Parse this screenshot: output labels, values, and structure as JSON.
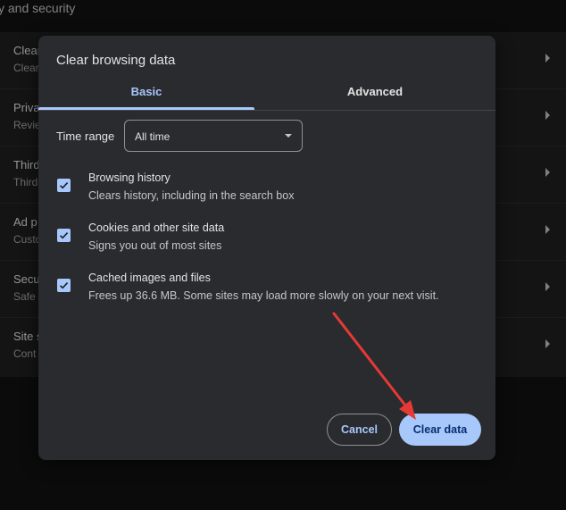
{
  "background": {
    "section_title": "y and security",
    "rows": [
      {
        "title": "Clear",
        "sub": "Clear"
      },
      {
        "title": "Priva",
        "sub": "Revie"
      },
      {
        "title": "Third",
        "sub": "Third"
      },
      {
        "title": "Ad p",
        "sub": "Custo"
      },
      {
        "title": "Secu",
        "sub": "Safe"
      },
      {
        "title": "Site s",
        "sub": "Cont"
      }
    ]
  },
  "dialog": {
    "title": "Clear browsing data",
    "tabs": [
      {
        "label": "Basic",
        "active": true
      },
      {
        "label": "Advanced",
        "active": false
      }
    ],
    "time_range": {
      "label": "Time range",
      "value": "All time"
    },
    "options": [
      {
        "title": "Browsing history",
        "sub": "Clears history, including in the search box",
        "checked": true
      },
      {
        "title": "Cookies and other site data",
        "sub": "Signs you out of most sites",
        "checked": true
      },
      {
        "title": "Cached images and files",
        "sub": "Frees up 36.6 MB. Some sites may load more slowly on your next visit.",
        "checked": true
      }
    ],
    "buttons": {
      "cancel": "Cancel",
      "clear": "Clear data"
    }
  },
  "colors": {
    "accent": "#a8c7fa",
    "dialog_bg": "#2a2b2f",
    "annotation_arrow": "#e53935"
  },
  "icons": [
    "chevron-right-icon",
    "dropdown-caret-icon",
    "checkmark-icon",
    "annotation-arrow"
  ]
}
